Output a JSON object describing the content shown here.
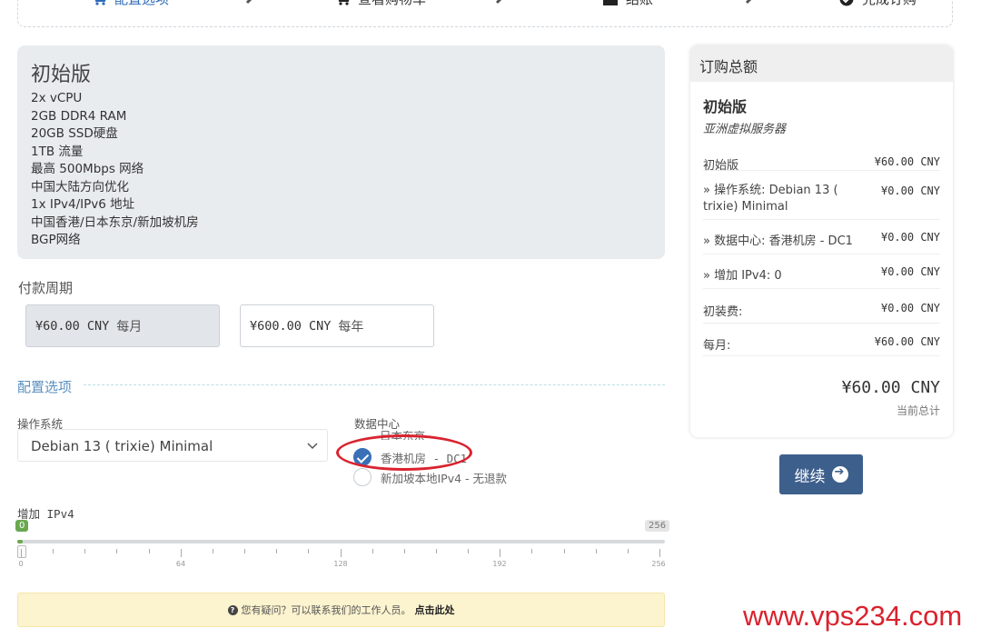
{
  "stepper": {
    "steps": [
      {
        "label": "配置选项",
        "icon": "cart-gear-icon"
      },
      {
        "label": "查看购物车",
        "icon": "cart-icon"
      },
      {
        "label": "结账",
        "icon": "cash-register-icon"
      },
      {
        "label": "完成订购",
        "icon": "check-circle-icon"
      }
    ],
    "active_color": "#2d6bb8"
  },
  "product": {
    "name": "初始版",
    "features": [
      "2x vCPU",
      "2GB DDR4 RAM",
      "20GB SSD硬盘",
      "1TB 流量",
      "最高 500Mbps 网络",
      "中国大陆方向优化",
      "1x IPv4/IPv6 地址",
      "中国香港/日本东京/新加坡机房",
      "BGP网络"
    ]
  },
  "billing": {
    "title": "付款周期",
    "options": [
      {
        "price": "¥60.00 CNY",
        "period": "每月",
        "selected": true
      },
      {
        "price": "¥600.00 CNY",
        "period": "每年",
        "selected": false
      }
    ]
  },
  "config": {
    "title": "配置选项",
    "os_label": "操作系统",
    "os_value": "Debian 13 ( trixie) Minimal",
    "dc_label": "数据中心",
    "dc_options": [
      {
        "label": "日本东京",
        "checked": false
      },
      {
        "label": "香港机房 - DC1",
        "checked": true
      },
      {
        "label": "新加坡本地IPv4 - 无退款",
        "checked": false
      }
    ],
    "ipv4_label": "增加 IPv4",
    "ipv4_value": "0",
    "ipv4_max": "256",
    "ticks": [
      "0",
      "64",
      "128",
      "192",
      "256"
    ]
  },
  "help": {
    "text": "您有疑问？可以联系我们的工作人员。",
    "link": "点击此处"
  },
  "summary": {
    "title": "订购总额",
    "product": "初始版",
    "group": "亚洲虚拟服务器",
    "lines": [
      {
        "label": "初始版",
        "amount": "¥60.00 CNY"
      },
      {
        "label": "» 操作系统: Debian 13 ( trixie) Minimal",
        "amount": "¥0.00 CNY"
      },
      {
        "label": "» 数据中心: 香港机房 - DC1",
        "amount": "¥0.00 CNY"
      },
      {
        "label": "» 增加 IPv4: 0",
        "amount": "¥0.00 CNY"
      },
      {
        "label": "初装费:",
        "amount": "¥0.00 CNY"
      },
      {
        "label": "每月:",
        "amount": "¥60.00 CNY"
      }
    ],
    "total": "¥60.00 CNY",
    "total_caption": "当前总计"
  },
  "continue_label": "继续",
  "watermark": "www.vps234.com"
}
